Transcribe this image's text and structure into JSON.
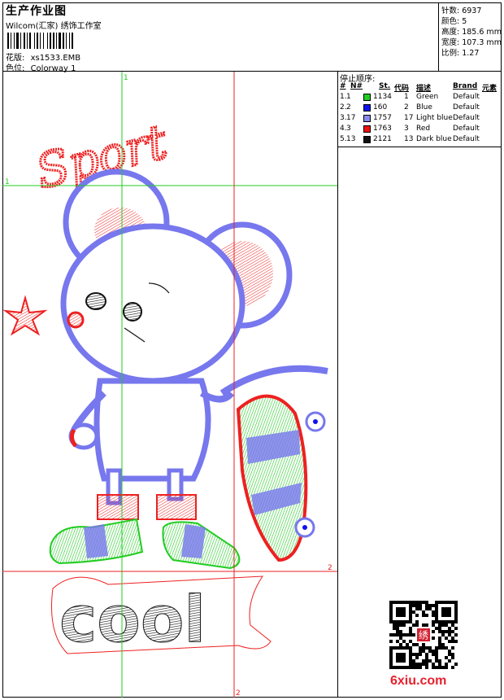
{
  "header": {
    "title": "生产作业图",
    "studio": "Wilcom(汇家) 绣饰工作室",
    "design_file_label": "花版:",
    "design_file": "xs1533.EMB",
    "colorway_label": "色位:",
    "colorway": "Colorway 1"
  },
  "stats": {
    "stitches": "针数: 6937",
    "colors": "颜色: 5",
    "height": "高度: 185.6 mm",
    "width": "宽度: 107.3 mm",
    "scale": "比例: 1.27"
  },
  "stop_sequence": {
    "label": "停止顺序:",
    "headers": [
      "#",
      "N#",
      "St.",
      "代码",
      "描述",
      "Brand",
      "元素"
    ],
    "rows": [
      {
        "idx": "1.",
        "n": "1",
        "st": "1134",
        "code": "1",
        "desc": "Green",
        "brand": "Default",
        "color": "#22cc22"
      },
      {
        "idx": "2.",
        "n": "2",
        "st": "160",
        "code": "2",
        "desc": "Blue",
        "brand": "Default",
        "color": "#1111ee"
      },
      {
        "idx": "3.",
        "n": "17",
        "st": "1757",
        "code": "17",
        "desc": "Light blue",
        "brand": "Default",
        "color": "#8888ee"
      },
      {
        "idx": "4.",
        "n": "3",
        "st": "1763",
        "code": "3",
        "desc": "Red",
        "brand": "Default",
        "color": "#ee1111"
      },
      {
        "idx": "5.",
        "n": "13",
        "st": "2121",
        "code": "13",
        "desc": "Dark blue",
        "brand": "Default",
        "color": "#111111"
      }
    ]
  },
  "guides": {
    "v1": "1",
    "h1": "1",
    "v2": "2",
    "h2": "2"
  },
  "artwork": {
    "script_text": "Sport",
    "bottom_text": "cool"
  },
  "watermark": {
    "logo": "6xiu.com",
    "seal": "绣"
  }
}
